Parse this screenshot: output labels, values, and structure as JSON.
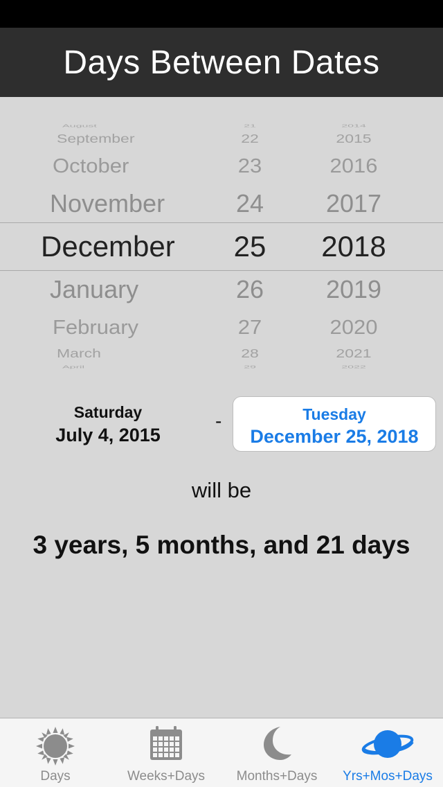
{
  "nav": {
    "title": "Days Between Dates"
  },
  "picker": {
    "months": [
      "August",
      "September",
      "October",
      "November",
      "December",
      "January",
      "February",
      "March",
      "April"
    ],
    "days": [
      "21",
      "22",
      "23",
      "24",
      "25",
      "26",
      "27",
      "28",
      "29"
    ],
    "years": [
      "2014",
      "2015",
      "2016",
      "2017",
      "2018",
      "2019",
      "2020",
      "2021",
      "2022"
    ],
    "selected": {
      "month": "December",
      "day": "25",
      "year": "2018"
    }
  },
  "comparison": {
    "from": {
      "weekday": "Saturday",
      "date": "July 4, 2015"
    },
    "separator": "-",
    "to": {
      "weekday": "Tuesday",
      "date": "December 25, 2018"
    },
    "connector": "will be",
    "result": "3 years, 5 months, and 21 days"
  },
  "tabs": [
    {
      "label": "Days",
      "icon": "sun-icon",
      "active": false
    },
    {
      "label": "Weeks+Days",
      "icon": "calendar-icon",
      "active": false
    },
    {
      "label": "Months+Days",
      "icon": "moon-icon",
      "active": false
    },
    {
      "label": "Yrs+Mos+Days",
      "icon": "planet-icon",
      "active": true
    }
  ],
  "colors": {
    "accent": "#1a7ce6",
    "navbar": "#2e2e2e",
    "background": "#d7d7d7",
    "inactive_icon": "#8c8c8c"
  }
}
